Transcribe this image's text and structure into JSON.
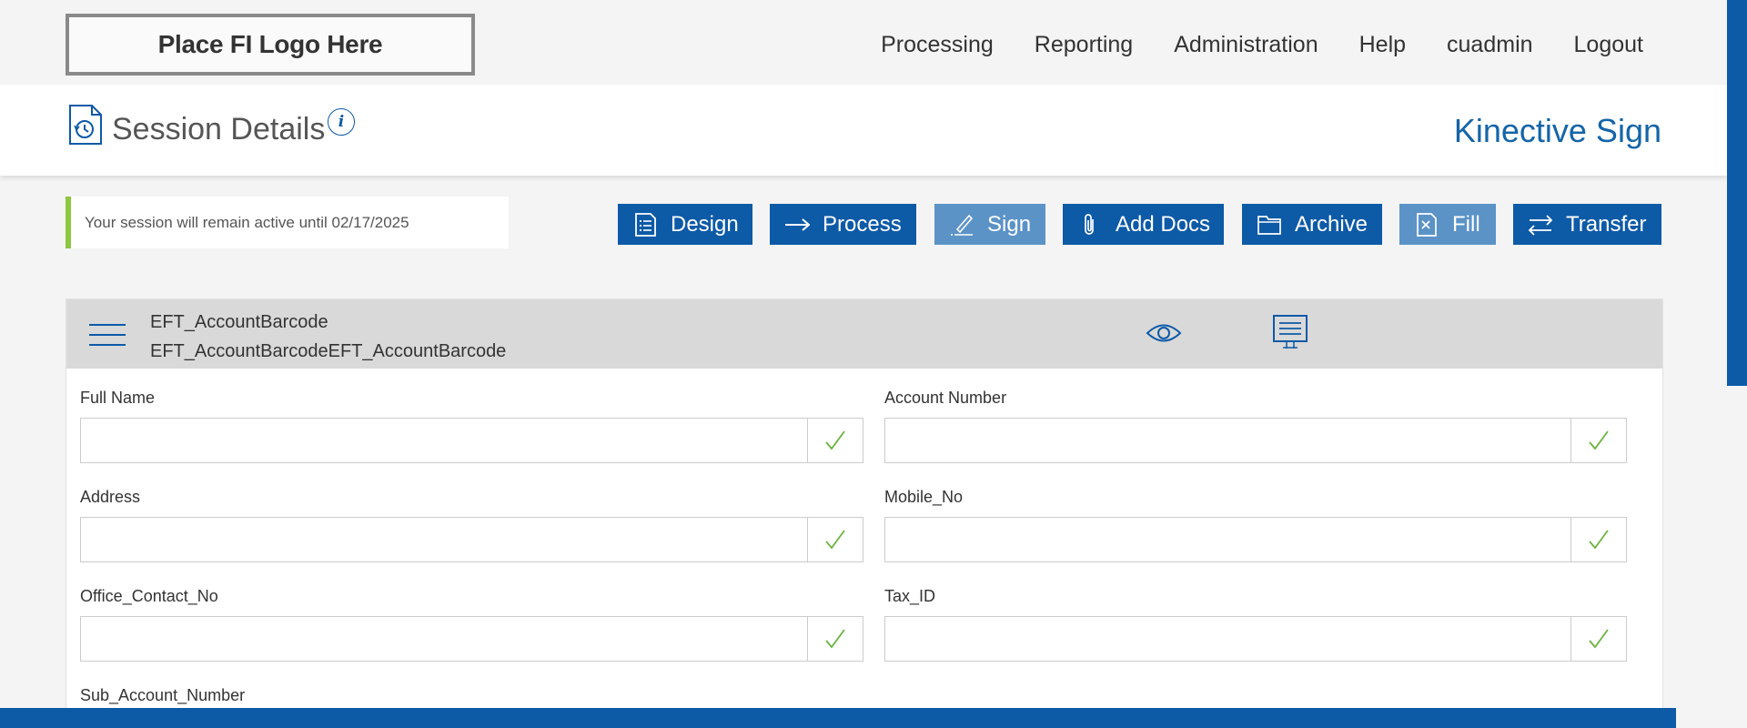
{
  "header": {
    "logo_text": "Place FI Logo Here",
    "nav": [
      "Processing",
      "Reporting",
      "Administration",
      "Help",
      "cuadmin",
      "Logout"
    ]
  },
  "title": {
    "page_title": "Session Details",
    "info_symbol": "i",
    "brand": "Kinective Sign"
  },
  "session": {
    "notice": "Your session will remain active until 02/17/2025"
  },
  "toolbar": {
    "design": "Design",
    "process": "Process",
    "sign": "Sign",
    "add_docs": "Add Docs",
    "archive": "Archive",
    "fill": "Fill",
    "transfer": "Transfer"
  },
  "document": {
    "name": "EFT_AccountBarcode",
    "subtitle": "EFT_AccountBarcodeEFT_AccountBarcode"
  },
  "fields": {
    "full_name": {
      "label": "Full Name",
      "value": ""
    },
    "account_number": {
      "label": "Account Number",
      "value": ""
    },
    "address": {
      "label": "Address",
      "value": ""
    },
    "mobile_no": {
      "label": "Mobile_No",
      "value": ""
    },
    "office_contact_no": {
      "label": "Office_Contact_No",
      "value": ""
    },
    "tax_id": {
      "label": "Tax_ID",
      "value": ""
    },
    "sub_account_number": {
      "label": "Sub_Account_Number",
      "value": ""
    }
  },
  "colors": {
    "primary": "#0d5aa7",
    "button_disabled": "#5b93c7",
    "notice_accent": "#8dc63f",
    "check": "#6cb33f"
  }
}
